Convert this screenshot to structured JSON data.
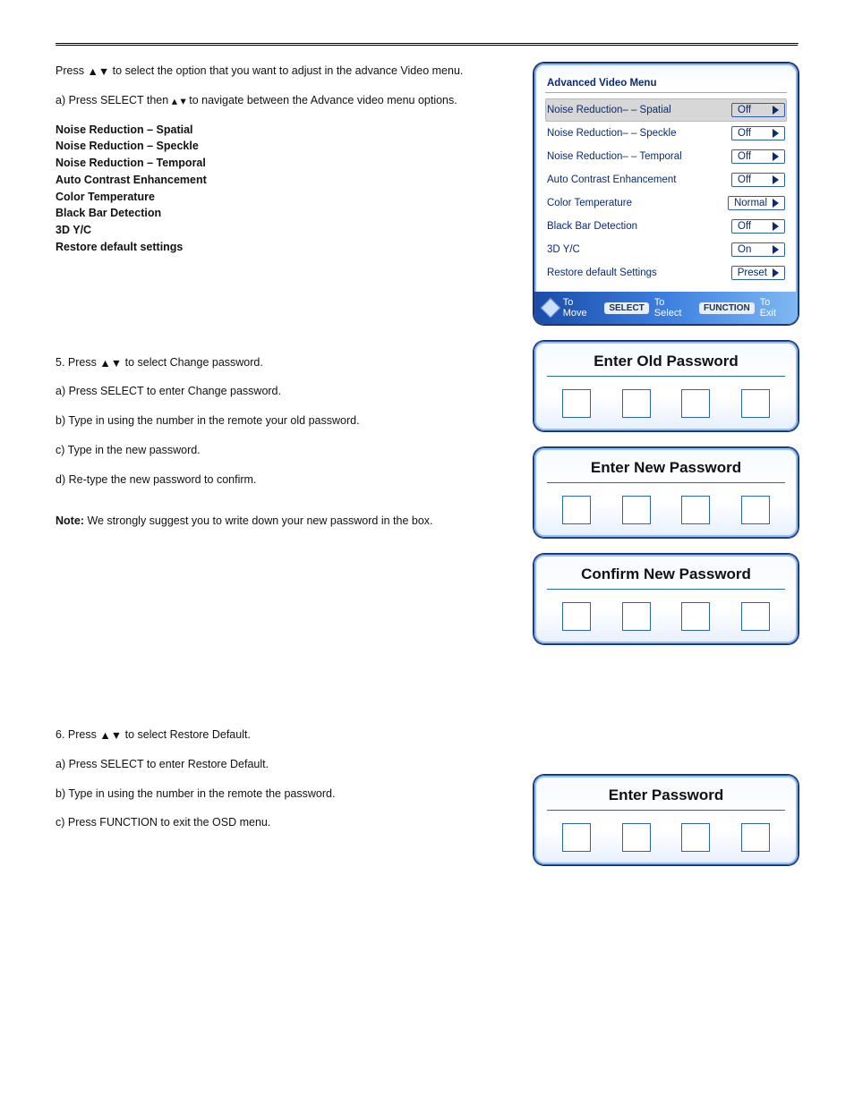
{
  "glyphs": {
    "up": "▲",
    "down": "▼",
    "upSmall": "▴",
    "downSmall": "▾"
  },
  "block1": {
    "press_prefix": "Press ",
    "press_suffix": " to select the option that you want to adjust in the advance Video menu.",
    "l2a": "a) Press SELECT then ",
    "l2b": " to navigate between the Advance video menu options.",
    "items": [
      "Noise Reduction – Spatial",
      "Noise Reduction – Speckle",
      "Noise Reduction – Temporal",
      "Auto Contrast Enhancement",
      "Color Temperature",
      "Black Bar Detection",
      "3D Y/C",
      "Restore default settings"
    ]
  },
  "block2": {
    "step": "5.",
    "press_prefix": "Press ",
    "press_suffix": " to select Change password.",
    "lines": [
      "a) Press SELECT to enter Change password.",
      "b) Type in using the number in the remote your old password.",
      "c) Type in the new password.",
      "d) Re-type the new password to confirm."
    ],
    "note_label": "Note:",
    "note_text": " We strongly suggest you to write down your new password in the box."
  },
  "block3": {
    "step": "6.",
    "press_prefix": "Press ",
    "press_suffix": " to select Restore Default.",
    "lines": [
      "a) Press SELECT to enter Restore Default.",
      "b) Type in using the number in the remote the password.",
      "c) Press FUNCTION to exit the OSD menu."
    ]
  },
  "osd": {
    "title": "Advanced Video Menu",
    "rows": [
      {
        "label": "Noise Reduction– – Spatial",
        "value": "Off",
        "selected": true
      },
      {
        "label": "Noise Reduction– – Speckle",
        "value": "Off",
        "selected": false
      },
      {
        "label": "Noise Reduction– – Temporal",
        "value": "Off",
        "selected": false
      },
      {
        "label": "Auto Contrast Enhancement",
        "value": "Off",
        "selected": false
      },
      {
        "label": "Color Temperature",
        "value": "Normal",
        "selected": false
      },
      {
        "label": "Black Bar Detection",
        "value": "Off",
        "selected": false
      },
      {
        "label": "3D Y/C",
        "value": "On",
        "selected": false
      },
      {
        "label": "Restore default Settings",
        "value": "Preset",
        "selected": false
      }
    ],
    "footer": {
      "move": "To Move",
      "selectKey": "SELECT",
      "select": "To Select",
      "funcKey": "FUNCTION",
      "exit": "To Exit"
    }
  },
  "pwd": {
    "old": "Enter Old Password",
    "new": "Enter New Password",
    "confirm": "Confirm New Password",
    "enter": "Enter Password"
  }
}
